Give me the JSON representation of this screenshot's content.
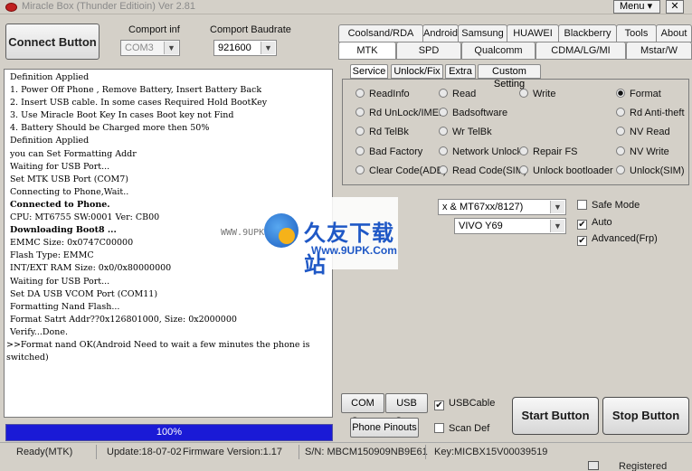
{
  "title_bar": {
    "title": "Miracle Box (Thunder Editioin) Ver 2.81",
    "menu_label": "Menu ▾",
    "close_label": "✕"
  },
  "connection": {
    "connect_label": "Connect Button",
    "comport_label": "Comport inf",
    "comport_value": "COM3",
    "baud_label": "Comport Baudrate",
    "baud_value": "921600"
  },
  "log_lines": [
    "Definition Applied",
    "1. Power Off Phone , Remove Battery, Insert Battery Back",
    "2. Insert USB cable. In some cases Required Hold BootKey",
    "3. Use Miracle Boot Key In cases Boot key not Find",
    "4. Battery Should be Charged more then 50%",
    "Definition Applied",
    "you can Set Formatting Addr",
    "Waiting for USB Port...",
    "Set MTK USB Port (COM7)",
    "Connecting to Phone,Wait..",
    "Connected to Phone.",
    "CPU: MT6755 SW:0001 Ver: CB00",
    "Downloading Boot8 ...",
    "EMMC Size: 0x0747C00000",
    "Flash Type: EMMC",
    "INT/EXT RAM  Size: 0x0/0x80000000",
    "Waiting for USB Port...",
    "Set DA USB VCOM Port (COM11)",
    "Formatting Nand Flash...",
    "Format Satrt Addr??0x126801000, Size: 0x2000000",
    "Verify...Done.",
    ">>Format nand OK(Android Need to wait a few minutes the phone is switched)"
  ],
  "progress": {
    "value": 1.0,
    "label": "100%"
  },
  "tabs_row1": [
    "Coolsand/RDA",
    "Android",
    "Samsung",
    "HUAWEI",
    "Blackberry",
    "Tools",
    "About"
  ],
  "tabs_row2": [
    "MTK",
    "SPD",
    "Qualcomm",
    "CDMA/LG/MI",
    "Mstar/W"
  ],
  "subtabs": [
    "Service",
    "Unlock/Fix",
    "Extra",
    "Custom Setting"
  ],
  "mtk_options": [
    {
      "label": "ReadInfo",
      "selected": false
    },
    {
      "label": "Read",
      "selected": false
    },
    {
      "label": "Write",
      "selected": false
    },
    {
      "label": "Format",
      "selected": true
    },
    {
      "label": "Rd UnLock/IMEI",
      "selected": false
    },
    {
      "label": "Badsoftware",
      "selected": false
    },
    {
      "label": "Rd Anti-theft",
      "selected": false
    },
    {
      "label": "Rd TelBk",
      "selected": false
    },
    {
      "label": "Wr TelBk",
      "selected": false
    },
    {
      "label": "NV Read",
      "selected": false
    },
    {
      "label": "Bad Factory",
      "selected": false
    },
    {
      "label": "Network Unlock",
      "selected": false
    },
    {
      "label": "Repair FS",
      "selected": false
    },
    {
      "label": "NV Write",
      "selected": false
    },
    {
      "label": "Clear Code(ADB)",
      "selected": false
    },
    {
      "label": "Read Code(SIM)",
      "selected": false
    },
    {
      "label": "Unlock bootloader",
      "selected": false
    },
    {
      "label": "Unlock(SIM)",
      "selected": false
    }
  ],
  "model": {
    "cpu_value": "x & MT67xx/8127)",
    "phone_value": "VIVO Y69"
  },
  "options": [
    {
      "label": "Safe Mode",
      "checked": false
    },
    {
      "label": "Auto",
      "checked": true
    },
    {
      "label": "Advanced(Frp)",
      "checked": true
    }
  ],
  "bottom": {
    "com_scan": "COM Scan",
    "usb_scan": "USB Scan",
    "usb_cable": "USBCable",
    "usb_cable_checked": true,
    "phone_pinouts": "Phone Pinouts",
    "scan_def": "Scan Def",
    "scan_def_checked": false,
    "start": "Start Button",
    "stop": "Stop Button"
  },
  "status": {
    "ready": "Ready(MTK)",
    "update": "Update:18-07-02",
    "firmware": "Firmware Version:1.17",
    "sn": "S/N: MBCM150909NB9E61",
    "key": "Key:MICBX15V00039519",
    "registered": "Registered"
  },
  "watermark": {
    "brand_cn": "久友下载站",
    "url": "Www.9UPK.Com",
    "small": "WWW.9UPK.COM"
  }
}
